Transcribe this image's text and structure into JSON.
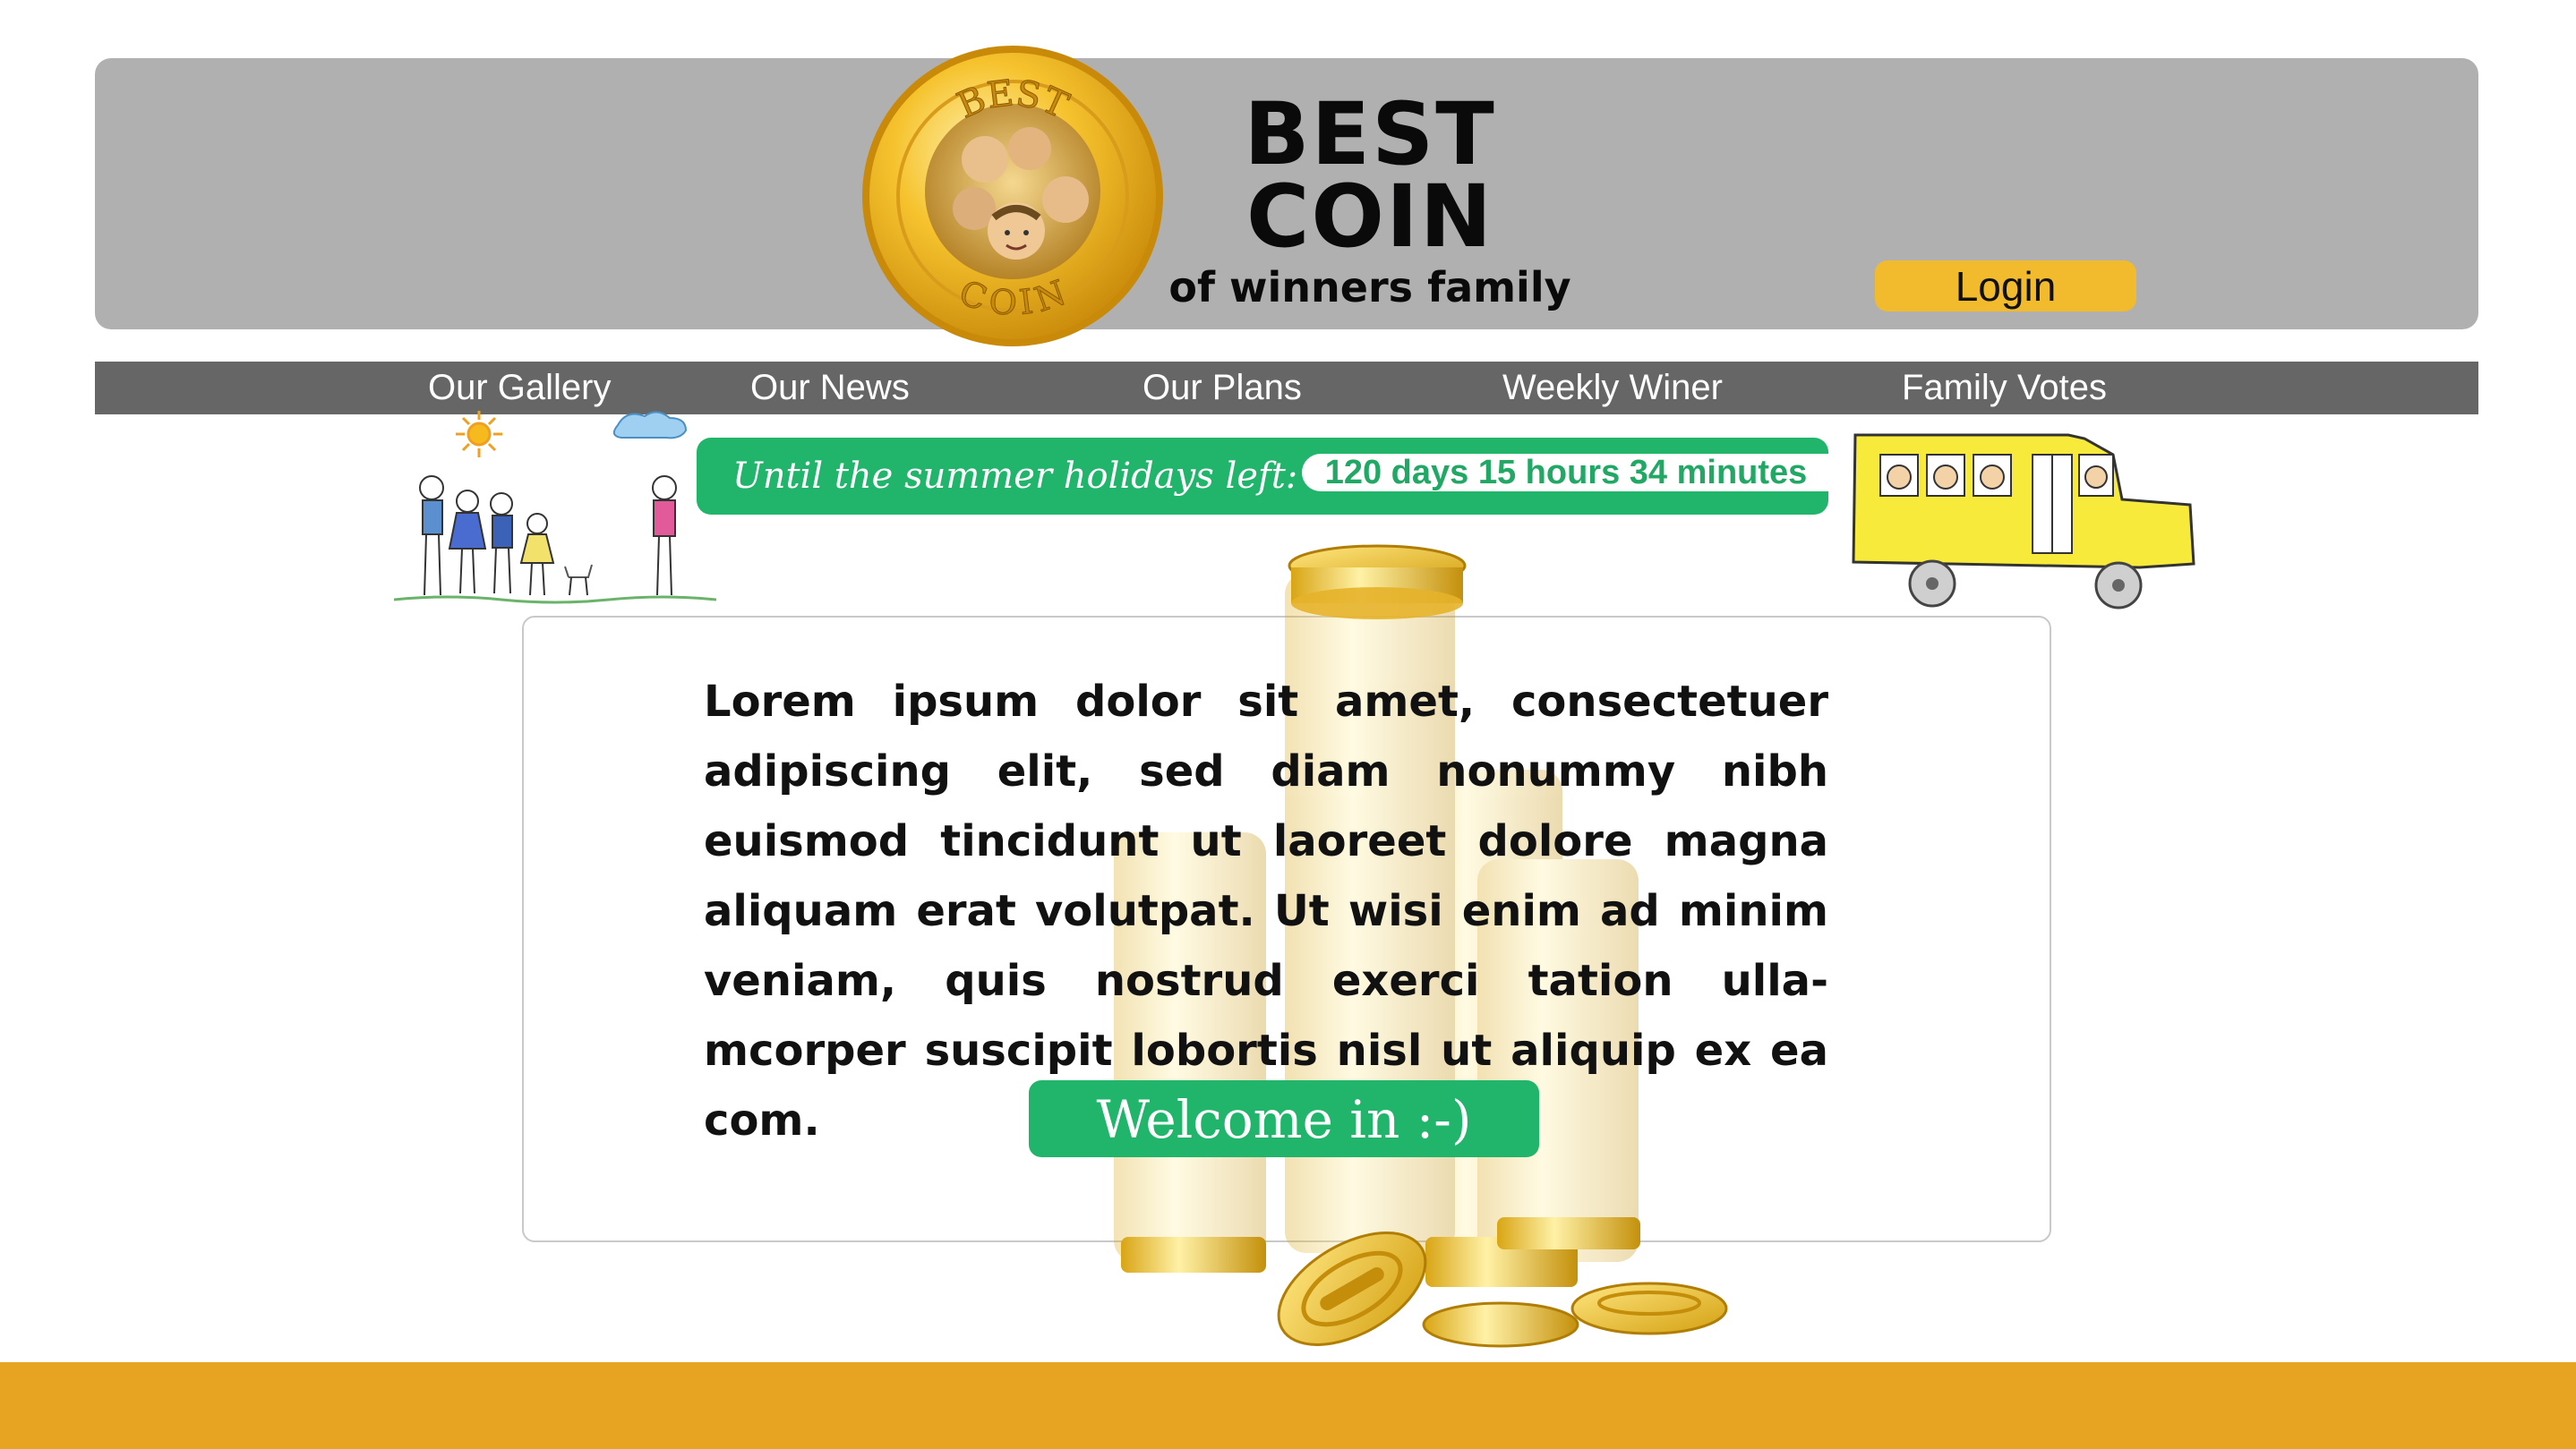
{
  "header": {
    "brand_line1": "BEST",
    "brand_line2": "COIN",
    "tagline": "of winners family",
    "logo_text_top": "BEST",
    "logo_text_bottom": "COIN",
    "login_label": "Login",
    "bg_color": "#b1b0b1",
    "login_color": "#f2bb2d"
  },
  "nav": {
    "items": [
      {
        "label": "Our Gallery"
      },
      {
        "label": "Our News"
      },
      {
        "label": "Our Plans"
      },
      {
        "label": "Weekly Winer"
      },
      {
        "label": "Family Votes"
      }
    ],
    "bg_color": "#666666"
  },
  "countdown": {
    "label": "Until the summer holidays left:",
    "value": "120 days 15 hours 34 minutes",
    "color": "#21b56c"
  },
  "main": {
    "body_text": "Lorem ipsum dolor sit amet, consectetuer adipiscing elit, sed diam nonummy nibh euismod tincidunt ut laoreet dolore magna aliquam erat volutpat. Ut wisi enim ad minim veniam, quis nostrud exerci tation ulla-mcorper suscipit lobortis nisl ut aliquip ex ea com.",
    "welcome_label": "Welcome in :-)"
  },
  "decor": {
    "family_drawing_icon": "kids-family-drawing-icon",
    "bus_drawing_icon": "school-bus-drawing-icon",
    "coins_icon": "gold-coin-stacks-icon"
  },
  "footer": {
    "color": "#e7a423"
  }
}
